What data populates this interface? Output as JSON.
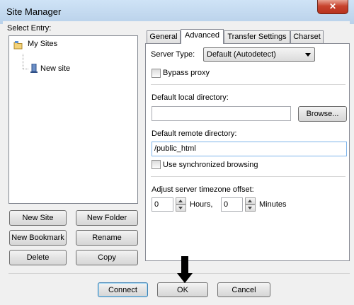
{
  "window": {
    "title": "Site Manager",
    "close_glyph": "✕"
  },
  "left": {
    "select_label": "Select Entry:",
    "tree": {
      "root": "My Sites",
      "child": "New site"
    },
    "buttons": {
      "new_site": "New Site",
      "new_folder": "New Folder",
      "new_bookmark": "New Bookmark",
      "rename": "Rename",
      "delete": "Delete",
      "copy": "Copy"
    }
  },
  "tabs": [
    "General",
    "Advanced",
    "Transfer Settings",
    "Charset"
  ],
  "active_tab": "Advanced",
  "advanced": {
    "server_type_label": "Server Type:",
    "server_type_value": "Default (Autodetect)",
    "bypass_proxy_label": "Bypass proxy",
    "bypass_proxy_checked": false,
    "local_dir_label": "Default local directory:",
    "local_dir_value": "",
    "browse_label": "Browse...",
    "remote_dir_label": "Default remote directory:",
    "remote_dir_value": "/public_html",
    "sync_browsing_label": "Use synchronized browsing",
    "sync_browsing_checked": false,
    "timezone_label": "Adjust server timezone offset:",
    "hours_value": "0",
    "hours_label": "Hours,",
    "minutes_value": "0",
    "minutes_label": "Minutes"
  },
  "footer": {
    "connect": "Connect",
    "ok": "OK",
    "cancel": "Cancel"
  },
  "icons": [
    "folder-icon",
    "site-icon",
    "spin-up-icon",
    "spin-down-icon",
    "dropdown-arrow-icon",
    "down-arrow-pointer"
  ]
}
